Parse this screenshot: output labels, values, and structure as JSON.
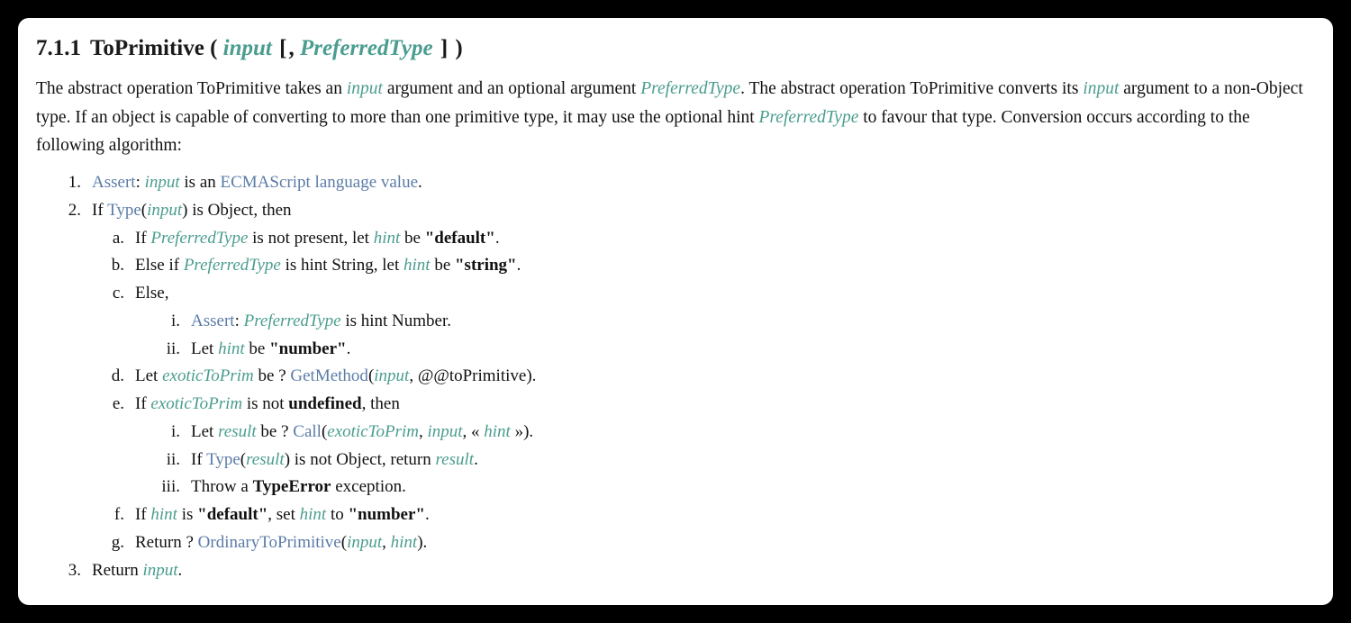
{
  "theme": {
    "background": "#000000",
    "panel": "#ffffff",
    "text": "#111111",
    "variable_teal": "#4a9d8f",
    "operation_blue": "#5b7ca8"
  },
  "heading": {
    "number": "7.1.1",
    "title": "ToPrimitive",
    "open_paren": "(",
    "param1": "input",
    "open_bracket": "[",
    "comma": ",",
    "param2": "PreferredType",
    "close_bracket": "]",
    "close_paren": ")"
  },
  "intro": {
    "t1": "The abstract operation ToPrimitive takes an ",
    "v1": "input",
    "t2": " argument and an optional argument ",
    "v2": "PreferredType",
    "t3": ". The abstract operation ToPrimitive converts its ",
    "v3": "input",
    "t4": " argument to a non-Object type. If an object is capable of converting to more than one primitive type, it may use the optional hint ",
    "v4": "PreferredType",
    "t5": " to favour that type. Conversion occurs according to the following algorithm:"
  },
  "algorithm": {
    "step1": {
      "marker": "1.",
      "assert": "Assert",
      "colon": ": ",
      "var_input": "input",
      "t1": " is an ",
      "link_ecma": "ECMAScript language value",
      "t2": "."
    },
    "step2": {
      "marker": "2.",
      "t1": "If ",
      "link_type": "Type",
      "paren_open": "(",
      "var_input": "input",
      "paren_close": ")",
      "t2": " is Object, then",
      "sub": {
        "a": {
          "marker": "a.",
          "t1": "If ",
          "var_pref": "PreferredType",
          "t2": " is not present, let ",
          "var_hint": "hint",
          "t3": " be ",
          "lit": "\"default\"",
          "t4": "."
        },
        "b": {
          "marker": "b.",
          "t1": "Else if ",
          "var_pref": "PreferredType",
          "t2": " is hint String, let ",
          "var_hint": "hint",
          "t3": " be ",
          "lit": "\"string\"",
          "t4": "."
        },
        "c": {
          "marker": "c.",
          "t1": "Else,",
          "sub": {
            "i": {
              "marker": "i.",
              "assert": "Assert",
              "colon": ": ",
              "var_pref": "PreferredType",
              "t1": " is hint Number."
            },
            "ii": {
              "marker": "ii.",
              "t1": "Let ",
              "var_hint": "hint",
              "t2": " be ",
              "lit": "\"number\"",
              "t3": "."
            }
          }
        },
        "d": {
          "marker": "d.",
          "t1": "Let ",
          "var_exotic": "exoticToPrim",
          "t2": " be ? ",
          "link_getmethod": "GetMethod",
          "paren_open": "(",
          "var_input": "input",
          "t3": ", ",
          "symbol": "@@toPrimitive",
          "paren_close": ")",
          "t4": "."
        },
        "e": {
          "marker": "e.",
          "t1": "If ",
          "var_exotic": "exoticToPrim",
          "t2": " is not ",
          "kw": "undefined",
          "t3": ", then",
          "sub": {
            "i": {
              "marker": "i.",
              "t1": "Let ",
              "var_result": "result",
              "t2": " be ? ",
              "link_call": "Call",
              "paren_open": "(",
              "var_exotic": "exoticToPrim",
              "c1": ", ",
              "var_input": "input",
              "c2": ", « ",
              "var_hint": "hint",
              "c3": " »",
              "paren_close": ")",
              "t3": "."
            },
            "ii": {
              "marker": "ii.",
              "t1": "If ",
              "link_type": "Type",
              "paren_open": "(",
              "var_result": "result",
              "paren_close": ")",
              "t2": " is not Object, return ",
              "var_result2": "result",
              "t3": "."
            },
            "iii": {
              "marker": "iii.",
              "t1": "Throw a ",
              "kw": "TypeError",
              "t2": " exception."
            }
          }
        },
        "f": {
          "marker": "f.",
          "t1": "If ",
          "var_hint": "hint",
          "t2": " is ",
          "lit1": "\"default\"",
          "t3": ", set ",
          "var_hint2": "hint",
          "t4": " to ",
          "lit2": "\"number\"",
          "t5": "."
        },
        "g": {
          "marker": "g.",
          "t1": "Return ? ",
          "link_ordinary": "OrdinaryToPrimitive",
          "paren_open": "(",
          "var_input": "input",
          "c1": ", ",
          "var_hint": "hint",
          "paren_close": ")",
          "t2": "."
        }
      }
    },
    "step3": {
      "marker": "3.",
      "t1": "Return ",
      "var_input": "input",
      "t2": "."
    }
  }
}
